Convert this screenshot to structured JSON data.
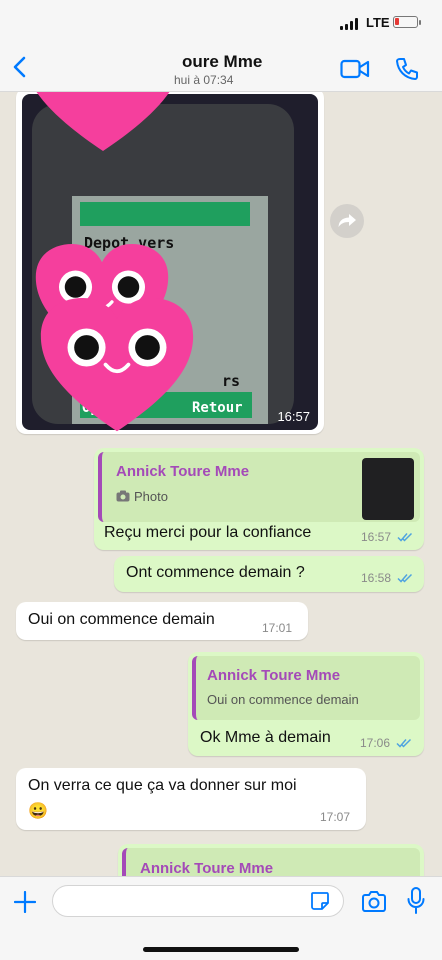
{
  "status_bar": {
    "time": "",
    "network": "LTE"
  },
  "header": {
    "contact_name": "oure Mme",
    "contact_status": "hui à 07:34"
  },
  "colors": {
    "accent": "#007aff",
    "outgoing_bubble": "#dcf8c6",
    "incoming_bubble": "#ffffff",
    "quote_bar": "#a44ab8",
    "chat_bg": "#e9e5dc"
  },
  "messages": [
    {
      "direction": "in",
      "type": "photo",
      "time": "16:57",
      "photo_text": {
        "top": "Depot vers",
        "mid": "rs",
        "bottom_left": "Op",
        "bottom_right": "Retour"
      }
    },
    {
      "direction": "out",
      "quote_author": "Annick Toure Mme",
      "quote_text": "Photo",
      "text": "Reçu merci pour la confiance",
      "time": "16:57",
      "status": "read"
    },
    {
      "direction": "out",
      "text": "Ont commence demain ?",
      "time": "16:58",
      "status": "read"
    },
    {
      "direction": "in",
      "text": "Oui on commence demain",
      "time": "17:01"
    },
    {
      "direction": "out",
      "quote_author": "Annick Toure Mme",
      "quote_text": "Oui on commence demain",
      "text": "Ok Mme à demain",
      "time": "17:06",
      "status": "read"
    },
    {
      "direction": "in",
      "text": "On verra ce que ça va donner sur moi",
      "emoji": "😀",
      "time": "17:07"
    },
    {
      "direction": "out",
      "quote_author": "Annick Toure Mme"
    }
  ],
  "icons": [
    "back-icon",
    "video-call-icon",
    "phone-call-icon",
    "forward-icon",
    "photo-camera-icon",
    "read-ticks-icon",
    "plus-icon",
    "sticker-icon",
    "camera-icon",
    "microphone-icon",
    "heart-face-sticker"
  ],
  "input": {
    "value": "",
    "placeholder": ""
  }
}
